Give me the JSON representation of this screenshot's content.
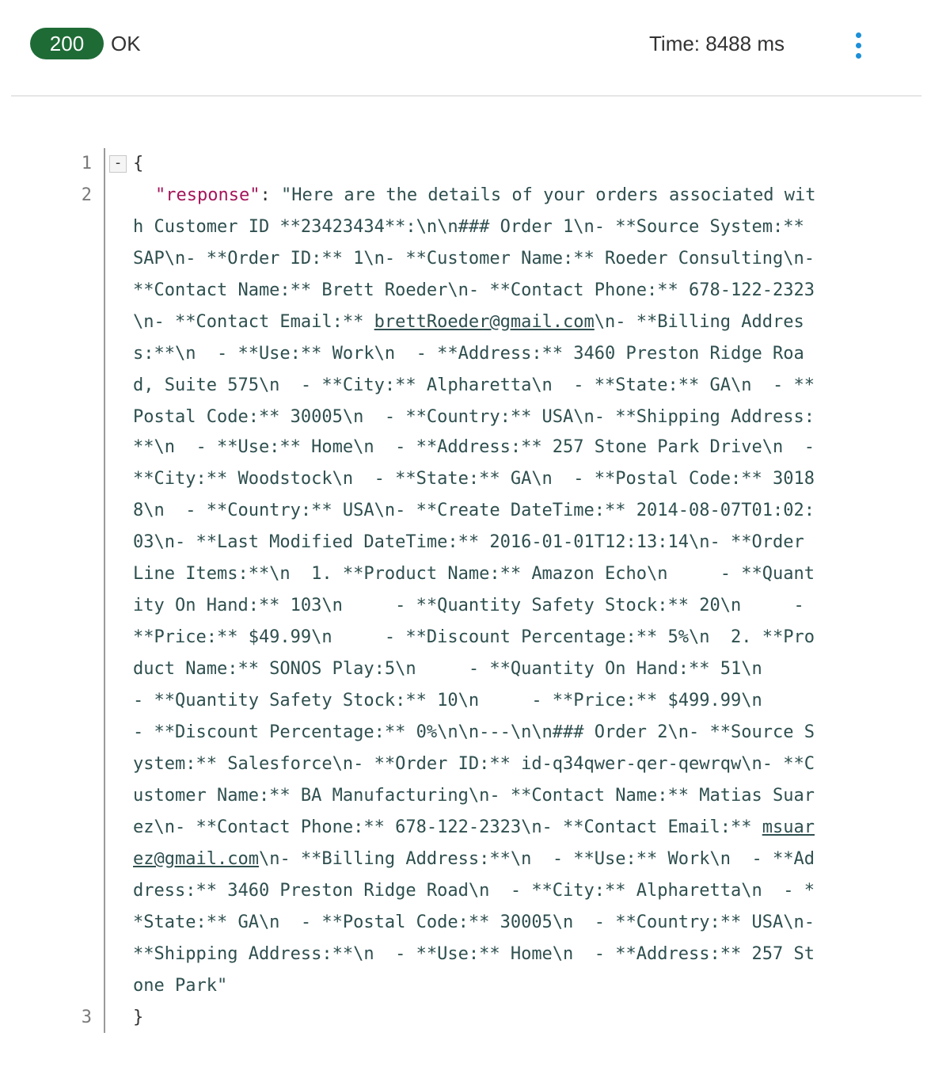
{
  "status": {
    "code": "200",
    "text": "OK",
    "time": "Time: 8488 ms",
    "pill_color": "#1e6b36",
    "menu_icon": "more-vertical-icon",
    "menu_icon_color": "#1c8fd8"
  },
  "editor": {
    "line_numbers": [
      "1",
      "2",
      "3"
    ],
    "fold_toggle": "-",
    "open_brace": "{",
    "close_brace": "}",
    "key": "\"response\"",
    "colon": ": ",
    "value_lines": [
      "\"Here are the details of your orders associated wit",
      "h Customer ID **23423434**:\\n\\n### Order 1\\n- **Source System:**",
      "SAP\\n- **Order ID:** 1\\n- **Customer Name:** Roeder Consulting\\n-",
      "**Contact Name:** Brett Roeder\\n- **Contact Phone:** 678-122-2323",
      "\\n- **Contact Email:** ",
      "s:**\\n  - **Use:** Work\\n  - **Address:** 3460 Preston Ridge Roa",
      "d, Suite 575\\n  - **City:** Alpharetta\\n  - **State:** GA\\n  - **",
      "Postal Code:** 30005\\n  - **Country:** USA\\n- **Shipping Address:",
      "**\\n  - **Use:** Home\\n  - **Address:** 257 Stone Park Drive\\n  -",
      "**City:** Woodstock\\n  - **State:** GA\\n  - **Postal Code:** 3018",
      "8\\n  - **Country:** USA\\n- **Create DateTime:** 2014-08-07T01:02:",
      "03\\n- **Last Modified DateTime:** 2016-01-01T12:13:14\\n- **Order",
      "Line Items:**\\n  1. **Product Name:** Amazon Echo\\n     - **Quant",
      "ity On Hand:** 103\\n     - **Quantity Safety Stock:** 20\\n     -",
      "**Price:** $49.99\\n     - **Discount Percentage:** 5%\\n  2. **Pro",
      "duct Name:** SONOS Play:5\\n     - **Quantity On Hand:** 51\\n",
      "- **Quantity Safety Stock:** 10\\n     - **Price:** $499.99\\n",
      "- **Discount Percentage:** 0%\\n\\n---\\n\\n### Order 2\\n- **Source S",
      "ystem:** Salesforce\\n- **Order ID:** id-q34qwer-qer-qewrqw\\n- **C",
      "ustomer Name:** BA Manufacturing\\n- **Contact Name:** Matias Suar",
      "ez\\n- **Contact Phone:** 678-122-2323\\n- **Contact Email:** ",
      "\\n- **Billing Address:**\\n  - **Use:** Work\\n  - **Ad",
      "dress:** 3460 Preston Ridge Road\\n  - **City:** Alpharetta\\n  - *",
      "*State:** GA\\n  - **Postal Code:** 30005\\n  - **Country:** USA\\n-",
      "**Shipping Address:**\\n  - **Use:** Home\\n  - **Address:** 257 St",
      "one Park\""
    ],
    "email1": "brettRoeder@gmail.com",
    "email1_after": "\\n- **Billing Addres",
    "email2_part1": "msuar",
    "email2_part2": "ez@gmail.com"
  }
}
